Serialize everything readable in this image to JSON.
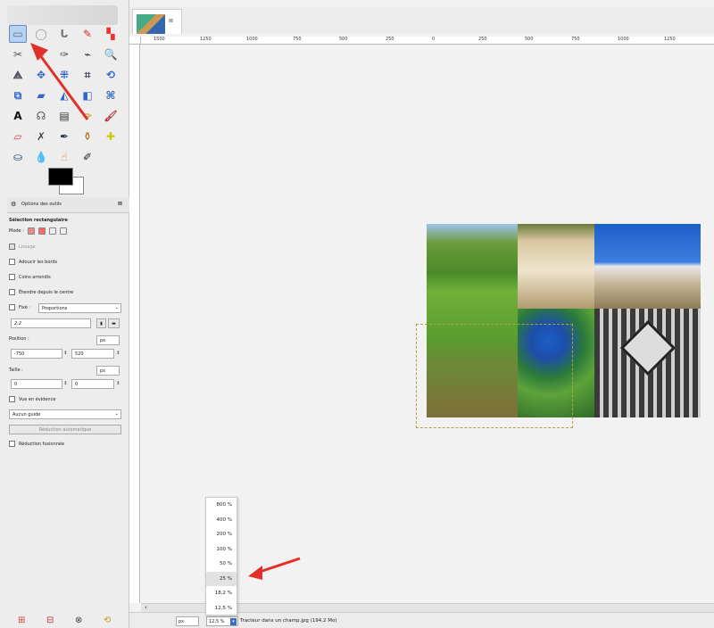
{
  "tools": [
    {
      "icon": "rect-select-icon",
      "glyph": "▭",
      "color": "#4a6fa5",
      "active": true
    },
    {
      "icon": "ellipse-select-icon",
      "glyph": "◯",
      "color": "#999"
    },
    {
      "icon": "free-select-icon",
      "glyph": "ᒐ",
      "color": "#777"
    },
    {
      "icon": "fuzzy-select-icon",
      "glyph": "✎",
      "color": "#c33"
    },
    {
      "icon": "color-select-icon",
      "glyph": "▚",
      "color": "#e33"
    },
    {
      "icon": "scissors-icon",
      "glyph": "✂",
      "color": "#555"
    },
    {
      "icon": "foreground-select-icon",
      "glyph": "✶",
      "color": "#c60"
    },
    {
      "icon": "paths-icon",
      "glyph": "✑",
      "color": "#444"
    },
    {
      "icon": "color-picker-icon",
      "glyph": "⌁",
      "color": "#333"
    },
    {
      "icon": "zoom-icon",
      "glyph": "🔍",
      "color": "#445"
    },
    {
      "icon": "measure-icon",
      "glyph": "⟁",
      "color": "#445"
    },
    {
      "icon": "move-icon",
      "glyph": "✥",
      "color": "#36c"
    },
    {
      "icon": "align-icon",
      "glyph": "⁜",
      "color": "#36c"
    },
    {
      "icon": "crop-icon",
      "glyph": "⌗",
      "color": "#445"
    },
    {
      "icon": "rotate-icon",
      "glyph": "⟲",
      "color": "#36c"
    },
    {
      "icon": "scale-icon",
      "glyph": "⧉",
      "color": "#36c"
    },
    {
      "icon": "shear-icon",
      "glyph": "▰",
      "color": "#36c"
    },
    {
      "icon": "perspective-icon",
      "glyph": "◭",
      "color": "#36c"
    },
    {
      "icon": "flip-icon",
      "glyph": "◧",
      "color": "#36c"
    },
    {
      "icon": "cage-icon",
      "glyph": "⌘",
      "color": "#36c"
    },
    {
      "icon": "text-icon",
      "glyph": "A",
      "color": "#111"
    },
    {
      "icon": "bucket-fill-icon",
      "glyph": "☊",
      "color": "#555"
    },
    {
      "icon": "blend-icon",
      "glyph": "▤",
      "color": "#333"
    },
    {
      "icon": "pencil-icon",
      "glyph": "✏",
      "color": "#c80"
    },
    {
      "icon": "paintbrush-icon",
      "glyph": "🖌",
      "color": "#a33"
    },
    {
      "icon": "eraser-icon",
      "glyph": "▱",
      "color": "#d44"
    },
    {
      "icon": "airbrush-icon",
      "glyph": "✗",
      "color": "#444"
    },
    {
      "icon": "ink-icon",
      "glyph": "✒",
      "color": "#235"
    },
    {
      "icon": "clone-icon",
      "glyph": "⚱",
      "color": "#a60"
    },
    {
      "icon": "heal-icon",
      "glyph": "✚",
      "color": "#cc0"
    },
    {
      "icon": "perspective-clone-icon",
      "glyph": "⛀",
      "color": "#246"
    },
    {
      "icon": "blur-icon",
      "glyph": "💧",
      "color": "#39c"
    },
    {
      "icon": "smudge-icon",
      "glyph": "☝",
      "color": "#c84"
    },
    {
      "icon": "dodge-burn-icon",
      "glyph": "✐",
      "color": "#222"
    }
  ],
  "options": {
    "tab_label": "Options des outils",
    "tool_name": "Sélection rectangulaire",
    "mode_label": "Mode :",
    "lissage": "Lissage",
    "adoucir": "Adoucir les bords",
    "coins": "Coins arrondis",
    "etendre": "Étendre depuis le centre",
    "fixe": "Fixé :",
    "fixe_value": "Proportions",
    "ratio": "2:2",
    "position_label": "Position :",
    "position_unit": "px",
    "pos_x": "-750",
    "pos_y": "520",
    "taille_label": "Taille :",
    "taille_unit": "px",
    "size_w": "0",
    "size_h": "0",
    "vue": "Vue en évidence",
    "guides": "Aucun guide",
    "auto_shrink": "Réduction automatique",
    "merged": "Réduction fusionnée"
  },
  "ruler_labels": [
    "1500",
    "1250",
    "1000",
    "750",
    "500",
    "250",
    "0",
    "250",
    "500",
    "750",
    "1000",
    "1250"
  ],
  "zoom_menu": [
    "800 %",
    "400 %",
    "200 %",
    "100 %",
    "50 %",
    "25 %",
    "18,2 %",
    "12,5 %"
  ],
  "zoom_selected": "25 %",
  "status": {
    "unit": "px",
    "zoom": "12,5 %",
    "text": "Tracteur dans un champ.jpg (194,2 Mo)"
  }
}
